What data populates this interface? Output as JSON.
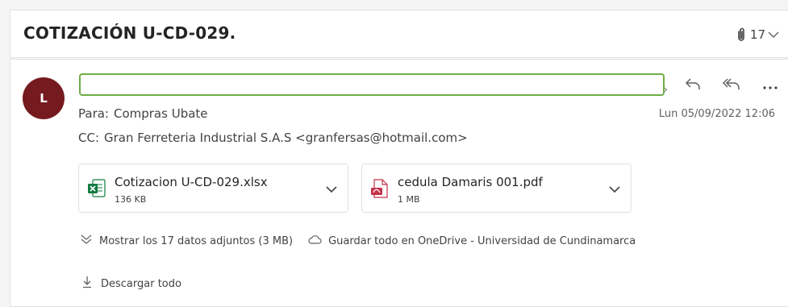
{
  "subject": "COTIZACIÓN U-CD-029.",
  "attachment_count": "17",
  "message": {
    "avatar_initial": "L",
    "to_label": "Para:",
    "to_value": "Compras Ubate",
    "date": "Lun 05/09/2022 12:06",
    "cc_label": "CC:",
    "cc_value": "Gran Ferreteria Industrial S.A.S <granfersas@hotmail.com>"
  },
  "attachments": [
    {
      "name": "Cotizacion U-CD-029.xlsx",
      "size": "136 KB",
      "icon": "excel-file-icon"
    },
    {
      "name": "cedula Damaris 001.pdf",
      "size": "1 MB",
      "icon": "pdf-file-icon"
    }
  ],
  "links": {
    "show_all": "Mostrar los 17 datos adjuntos (3 MB)",
    "save_onedrive": "Guardar todo en OneDrive - Universidad de Cundinamarca",
    "download_all": "Descargar todo"
  },
  "colors": {
    "avatar_bg": "#751a1f",
    "highlight_border": "#70ad47",
    "excel_green": "#107c41",
    "pdf_red": "#c4314b"
  }
}
